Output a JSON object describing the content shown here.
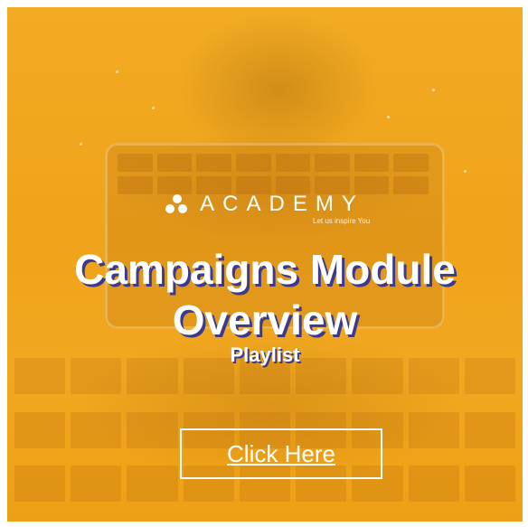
{
  "brand": {
    "name": "ACADEMY",
    "tagline": "Let us inspire You",
    "logo_icon": "triangle-dots-logo-icon"
  },
  "hero": {
    "title_line1": "Campaigns Module",
    "title_line2": "Overview",
    "subtitle": "Playlist"
  },
  "cta": {
    "label": "Click Here"
  },
  "colors": {
    "background": "#f0a61b",
    "text": "#ffffff",
    "title_shadow": "#3b3a8c"
  }
}
